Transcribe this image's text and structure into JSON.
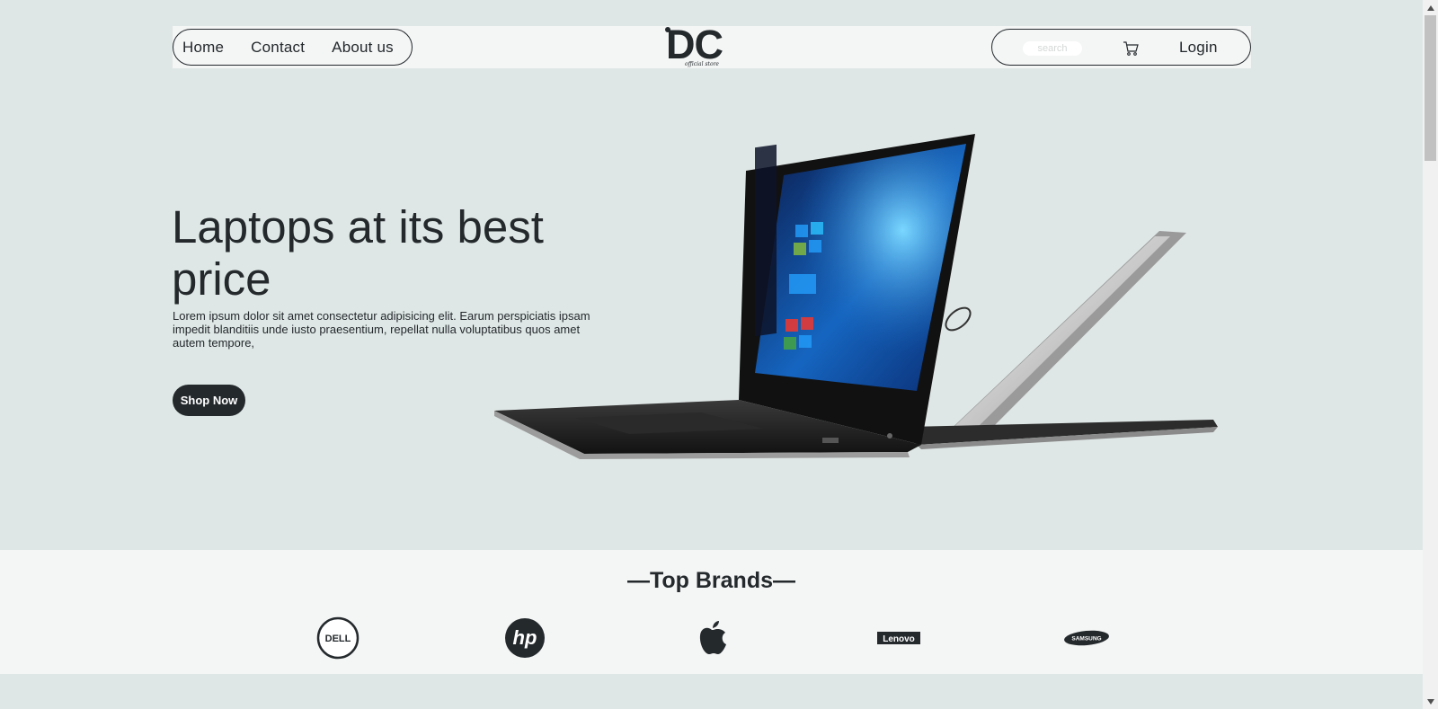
{
  "header": {
    "nav": [
      {
        "label": "Home"
      },
      {
        "label": "Contact"
      },
      {
        "label": "About us"
      }
    ],
    "logo": {
      "text": "DC",
      "tagline": "official store"
    },
    "search": {
      "placeholder": "search",
      "value": ""
    },
    "cart_icon": "cart-icon",
    "login_label": "Login"
  },
  "hero": {
    "title": "Laptops at its best price",
    "description": "Lorem ipsum dolor sit amet consectetur adipisicing elit. Earum perspiciatis ipsam impedit blanditiis unde iusto praesentium, repellat nulla voluptatibus quos amet autem tempore,",
    "cta_label": "Shop Now",
    "image": "laptop-image"
  },
  "brands": {
    "title": "—Top Brands—",
    "items": [
      {
        "name": "dell-logo",
        "text": "DELL"
      },
      {
        "name": "hp-logo",
        "text": "hp"
      },
      {
        "name": "apple-logo",
        "text": ""
      },
      {
        "name": "lenovo-logo",
        "text": "Lenovo"
      },
      {
        "name": "samsung-logo",
        "text": "SAMSUNG"
      }
    ]
  },
  "colors": {
    "background": "#dfe7e6",
    "header": "#f4f5f5",
    "dark": "#24292c",
    "button_text": "#ffffff"
  }
}
